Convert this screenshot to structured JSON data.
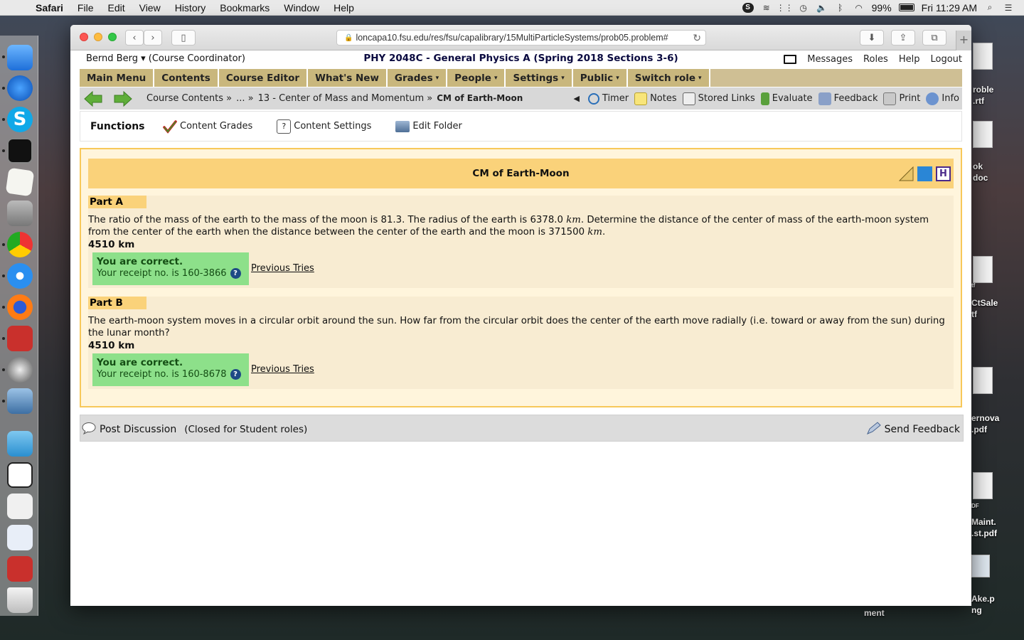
{
  "menubar": {
    "app": "Safari",
    "items": [
      "File",
      "Edit",
      "View",
      "History",
      "Bookmarks",
      "Window",
      "Help"
    ],
    "battery": "99%",
    "clock": "Fri 11:29 AM"
  },
  "browser": {
    "url": "loncapa10.fsu.edu/res/fsu/capalibrary/15MultiParticleSystems/prob05.problem#"
  },
  "userbar": {
    "user": "Bernd Berg ▾",
    "role": "(Course Coordinator)",
    "course": "PHY 2048C - General Physics A (Spring 2018 Sections 3-6)",
    "links": [
      "Messages",
      "Roles",
      "Help",
      "Logout"
    ]
  },
  "mainmenu": [
    {
      "label": "Main Menu",
      "caret": ""
    },
    {
      "label": "Contents",
      "caret": ""
    },
    {
      "label": "Course Editor",
      "caret": ""
    },
    {
      "label": "What's New",
      "caret": ""
    },
    {
      "label": "Grades",
      "caret": "▾"
    },
    {
      "label": "People",
      "caret": "▾"
    },
    {
      "label": "Settings",
      "caret": "▾"
    },
    {
      "label": "Public",
      "caret": "▾"
    },
    {
      "label": "Switch role",
      "caret": "▾"
    }
  ],
  "navbar": {
    "crumb1": "Course Contents »",
    "crumb2": "... »",
    "crumb3": "13 - Center of Mass and Momentum »",
    "current": "CM of Earth-Moon",
    "tools": [
      "Timer",
      "Notes",
      "Stored Links",
      "Evaluate",
      "Feedback",
      "Print",
      "Info"
    ]
  },
  "functions": {
    "title": "Functions",
    "items": [
      "Content Grades",
      "Content Settings",
      "Edit Folder"
    ]
  },
  "problem": {
    "title": "CM of Earth-Moon",
    "partA": {
      "label": "Part A",
      "text1": "The ratio of the mass of the earth to the mass of the moon is 81.3. The radius of the earth is 6378.0 ",
      "unit1": "km",
      "text2": ". Determine the distance of the center of mass of the earth-moon system from the center of the earth when the distance between the center of the earth and the moon is 371500 ",
      "unit2": "km",
      "text3": ".",
      "answer": "4510 km",
      "status": "You are correct.",
      "receipt": "Your receipt no. is 160-3866",
      "previous": "Previous Tries"
    },
    "partB": {
      "label": "Part B",
      "text": "The earth-moon system moves in a circular orbit around the sun. How far from the circular orbit does the center of the earth move radially (i.e. toward or away from the sun) during the lunar month?",
      "answer": "4510 km",
      "status": "You are correct.",
      "receipt": "Your receipt no. is 160-8678",
      "previous": "Previous Tries"
    }
  },
  "discussion": {
    "post": "Post Discussion",
    "closed": "(Closed for Student roles)",
    "send": "Send Feedback"
  },
  "desktop": {
    "labels": [
      "roble",
      ".rtf",
      "ok",
      "doc",
      "tf",
      "CtSale",
      "tf",
      "ernova",
      ".pdf",
      "DF",
      "Maint.",
      ".st.pdf",
      "Ake.p",
      "ng",
      "ment"
    ]
  }
}
